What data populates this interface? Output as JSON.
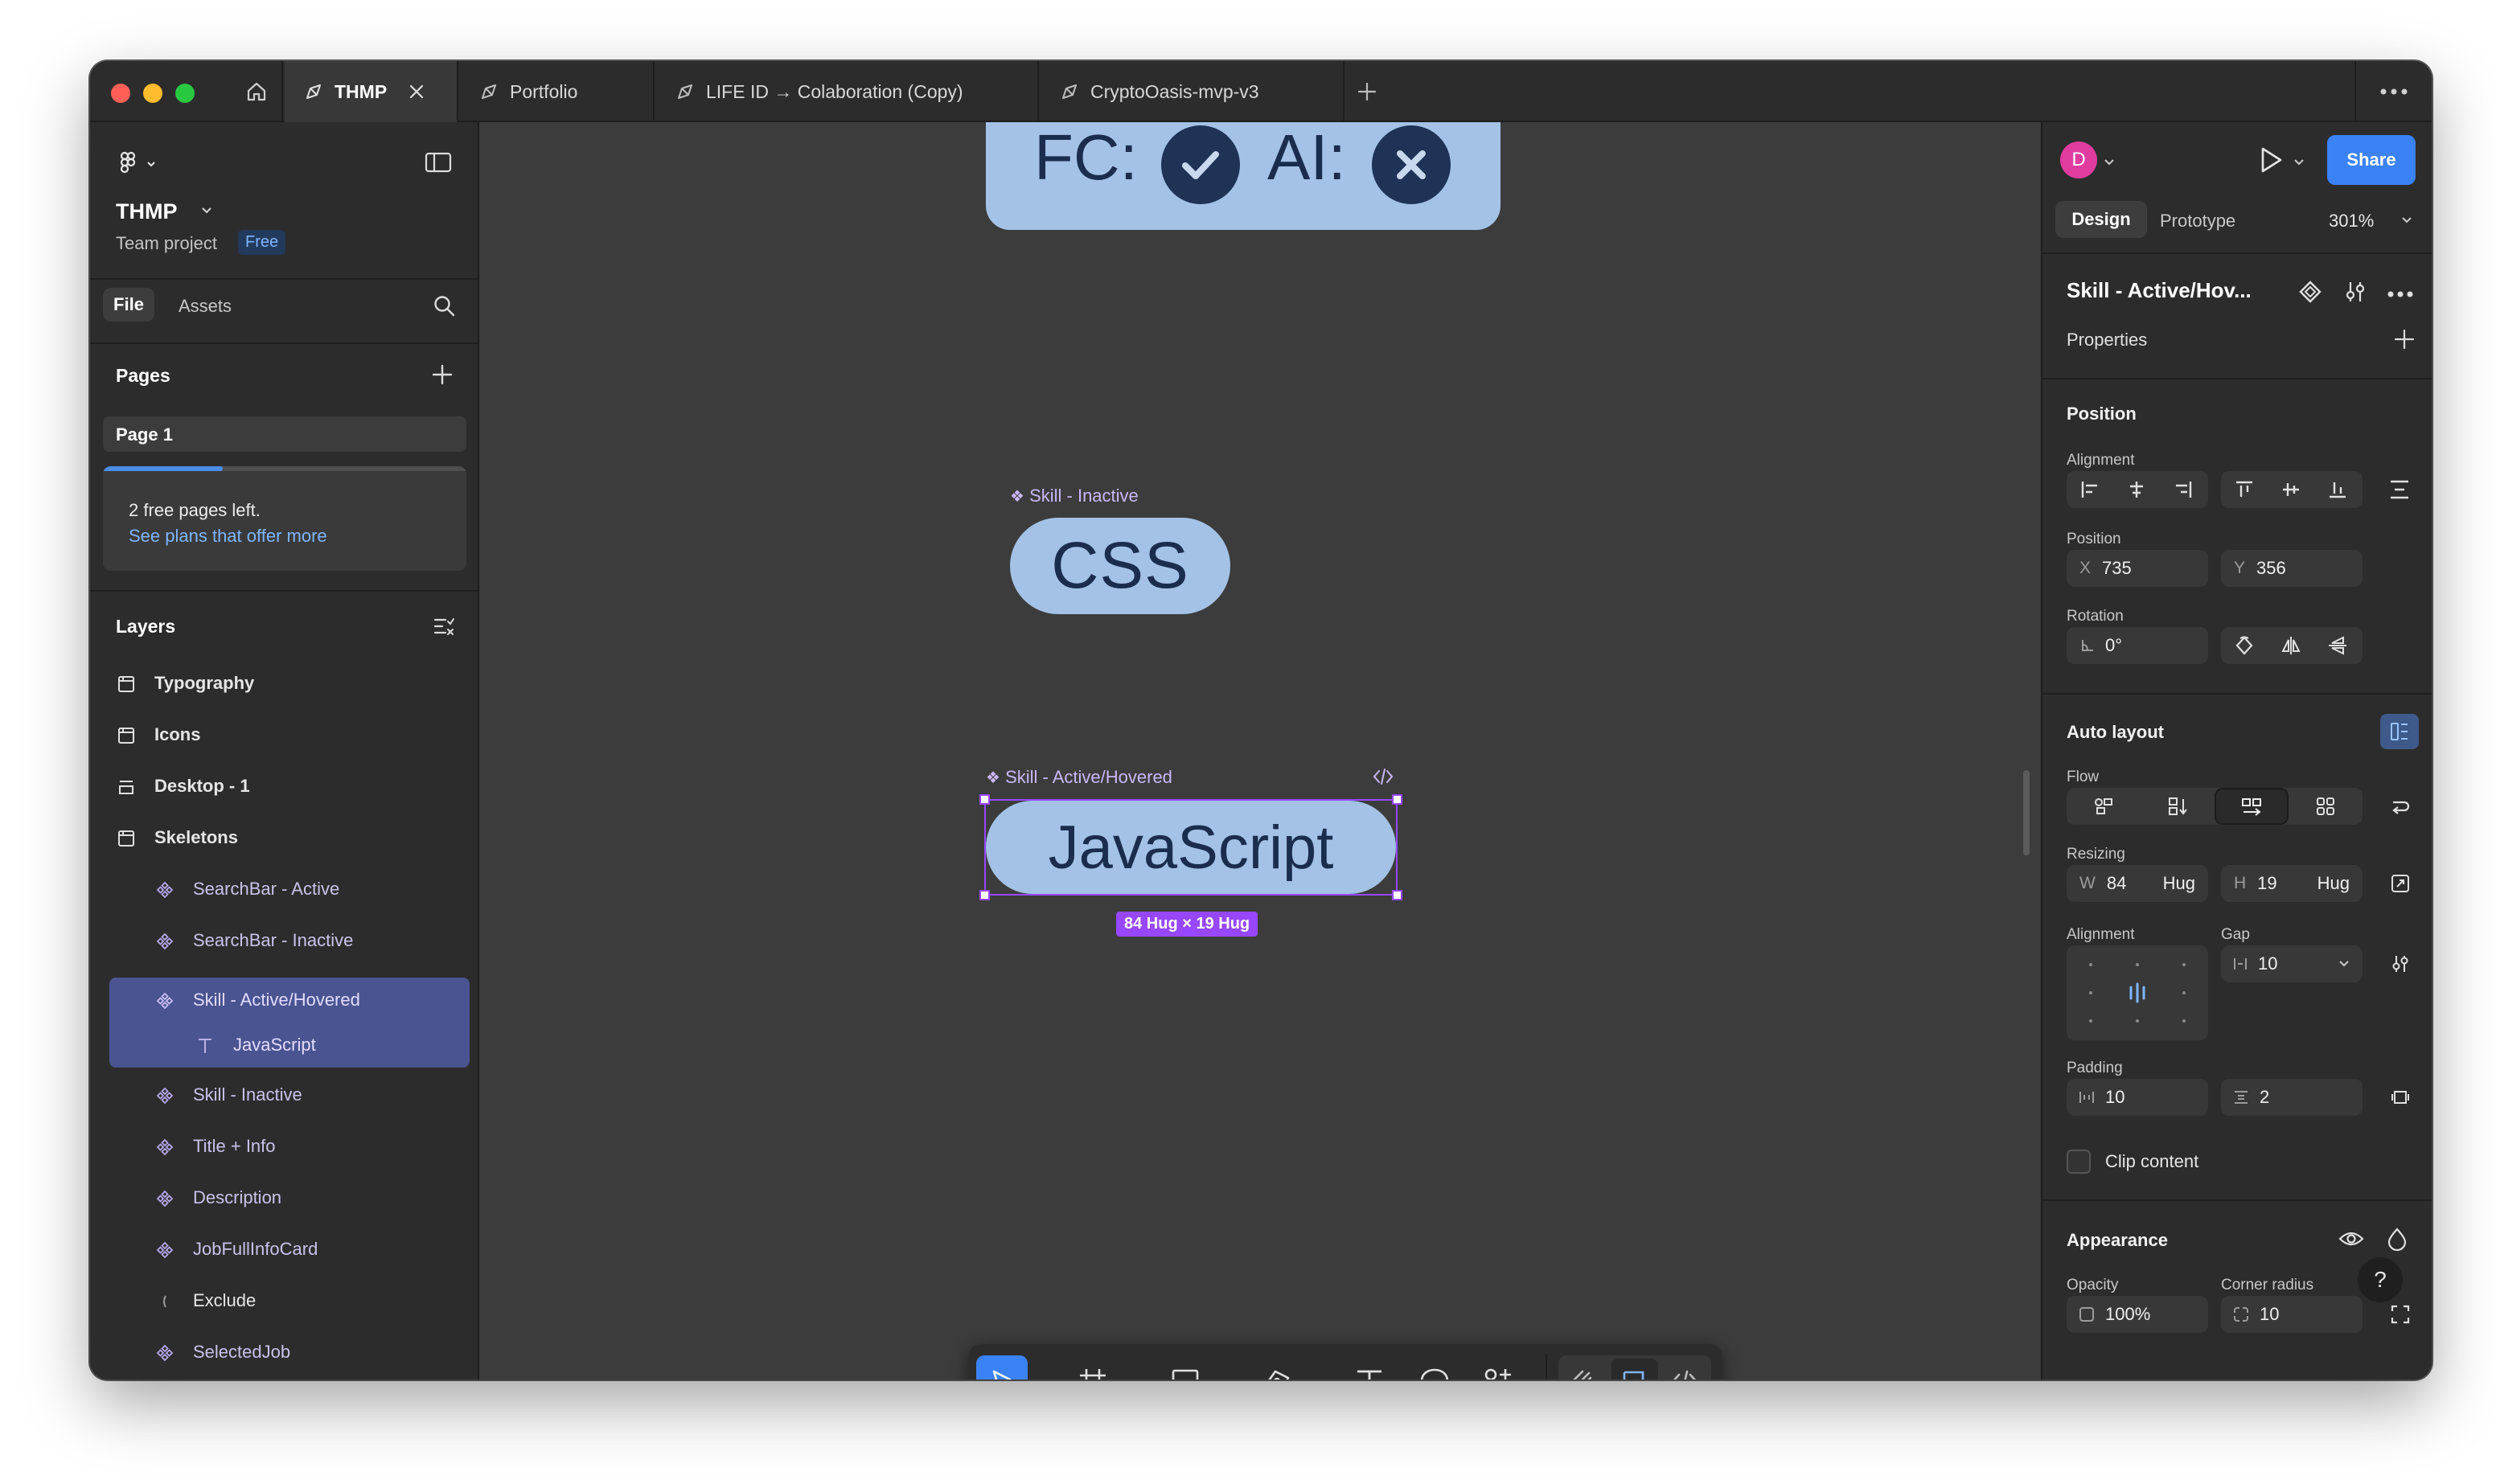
{
  "tabs": [
    {
      "label": "THMP",
      "active": true
    },
    {
      "label": "Portfolio"
    },
    {
      "label": "LIFE ID → Colaboration (Copy)"
    },
    {
      "label": "CryptoOasis-mvp-v3"
    }
  ],
  "left": {
    "project_name": "THMP",
    "project_team": "Team project",
    "plan_badge": "Free",
    "tab_file": "File",
    "tab_assets": "Assets",
    "pages_title": "Pages",
    "page1": "Page 1",
    "free_pages_text": "2 free pages left.",
    "plans_link": "See plans that offer more",
    "free_pages_progress": 0.33,
    "layers_title": "Layers",
    "layers": [
      {
        "label": "Typography",
        "icon": "frame-icon"
      },
      {
        "label": "Icons",
        "icon": "frame-icon"
      },
      {
        "label": "Desktop - 1",
        "icon": "section-icon"
      },
      {
        "label": "Skeletons",
        "icon": "frame-icon"
      },
      {
        "label": "SearchBar - Active",
        "icon": "component-icon"
      },
      {
        "label": "SearchBar - Inactive",
        "icon": "component-icon"
      },
      {
        "label": "Skill - Active/Hovered",
        "icon": "component-icon",
        "selected": true
      },
      {
        "label": "JavaScript",
        "icon": "text-icon",
        "selected": true
      },
      {
        "label": "Skill - Inactive",
        "icon": "component-icon"
      },
      {
        "label": "Title + Info",
        "icon": "component-icon"
      },
      {
        "label": "Description",
        "icon": "component-icon"
      },
      {
        "label": "JobFullInfoCard",
        "icon": "component-icon"
      },
      {
        "label": "Exclude",
        "icon": "boolean-icon"
      },
      {
        "label": "SelectedJob",
        "icon": "component-icon"
      }
    ]
  },
  "canvas": {
    "fc_text": "FC:",
    "ai_text": "AI:",
    "skill_inactive_label": "Skill - Inactive",
    "css_text": "CSS",
    "skill_active_label": "Skill - Active/Hovered",
    "js_text": "JavaScript",
    "size_badge": "84 Hug × 19 Hug"
  },
  "right": {
    "avatar_letter": "D",
    "share_label": "Share",
    "tab_design": "Design",
    "tab_prototype": "Prototype",
    "zoom": "301%",
    "component_name": "Skill - Active/Hov...",
    "properties_title": "Properties",
    "position_title": "Position",
    "alignment_label": "Alignment",
    "position_label": "Position",
    "x_key": "X",
    "x_value": "735",
    "y_key": "Y",
    "y_value": "356",
    "rotation_label": "Rotation",
    "rotation_value": "0°",
    "autolayout_title": "Auto layout",
    "flow_label": "Flow",
    "resizing_label": "Resizing",
    "w_key": "W",
    "w_value": "84",
    "w_mode": "Hug",
    "h_key": "H",
    "h_value": "19",
    "h_mode": "Hug",
    "align_label": "Alignment",
    "gap_label": "Gap",
    "gap_value": "10",
    "padding_label": "Padding",
    "pad_h_value": "10",
    "pad_v_value": "2",
    "clip_label": "Clip content",
    "appearance_title": "Appearance",
    "opacity_label": "Opacity",
    "opacity_value": "100%",
    "radius_label": "Corner radius",
    "radius_value": "10",
    "help": "?"
  },
  "colors": {
    "accent": "#4a8de8",
    "selection": "#9747ff",
    "pill_fill": "#a3c2e6",
    "pill_text": "#1b2d4f",
    "component_purple": "#c9b8f7"
  }
}
